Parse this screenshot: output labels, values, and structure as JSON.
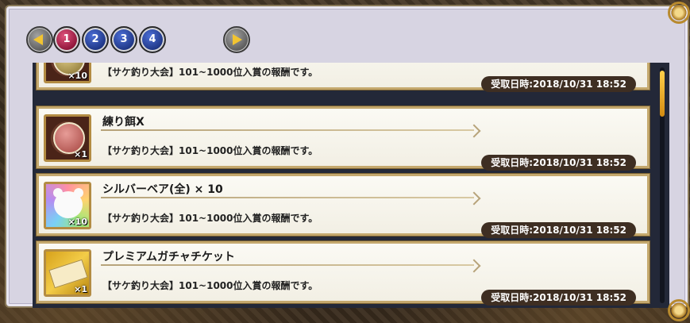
{
  "pagination": {
    "prev_icon": "arrow-left-icon",
    "next_icon": "arrow-right-icon",
    "pages": [
      "1",
      "2",
      "3",
      "4"
    ],
    "active_page": "1"
  },
  "rewards": [
    {
      "name": "",
      "quantity": "×10",
      "description": "【サケ釣り大会】101~1000位入賞の報酬です。",
      "received": "受取日時:2018/10/31 18:52",
      "icon": "gold-coin-icon"
    },
    {
      "name": "練り餌X",
      "quantity": "×1",
      "description": "【サケ釣り大会】101~1000位入賞の報酬です。",
      "received": "受取日時:2018/10/31 18:52",
      "icon": "bait-icon"
    },
    {
      "name": "シルバーベア(全) × 10",
      "quantity": "×10",
      "description": "【サケ釣り大会】101~1000位入賞の報酬です。",
      "received": "受取日時:2018/10/31 18:52",
      "icon": "silver-bear-icon"
    },
    {
      "name": "プレミアムガチャチケット",
      "quantity": "×1",
      "description": "【サケ釣り大会】101~1000位入賞の報酬です。",
      "received": "受取日時:2018/10/31 18:52",
      "icon": "gacha-ticket-icon"
    }
  ],
  "scroll": {
    "position": 0.0
  },
  "colors": {
    "accent": "#f2c431",
    "active_page": "#b81b4a",
    "page_button": "#2a46a5",
    "date_badge": "#3e2e22"
  }
}
